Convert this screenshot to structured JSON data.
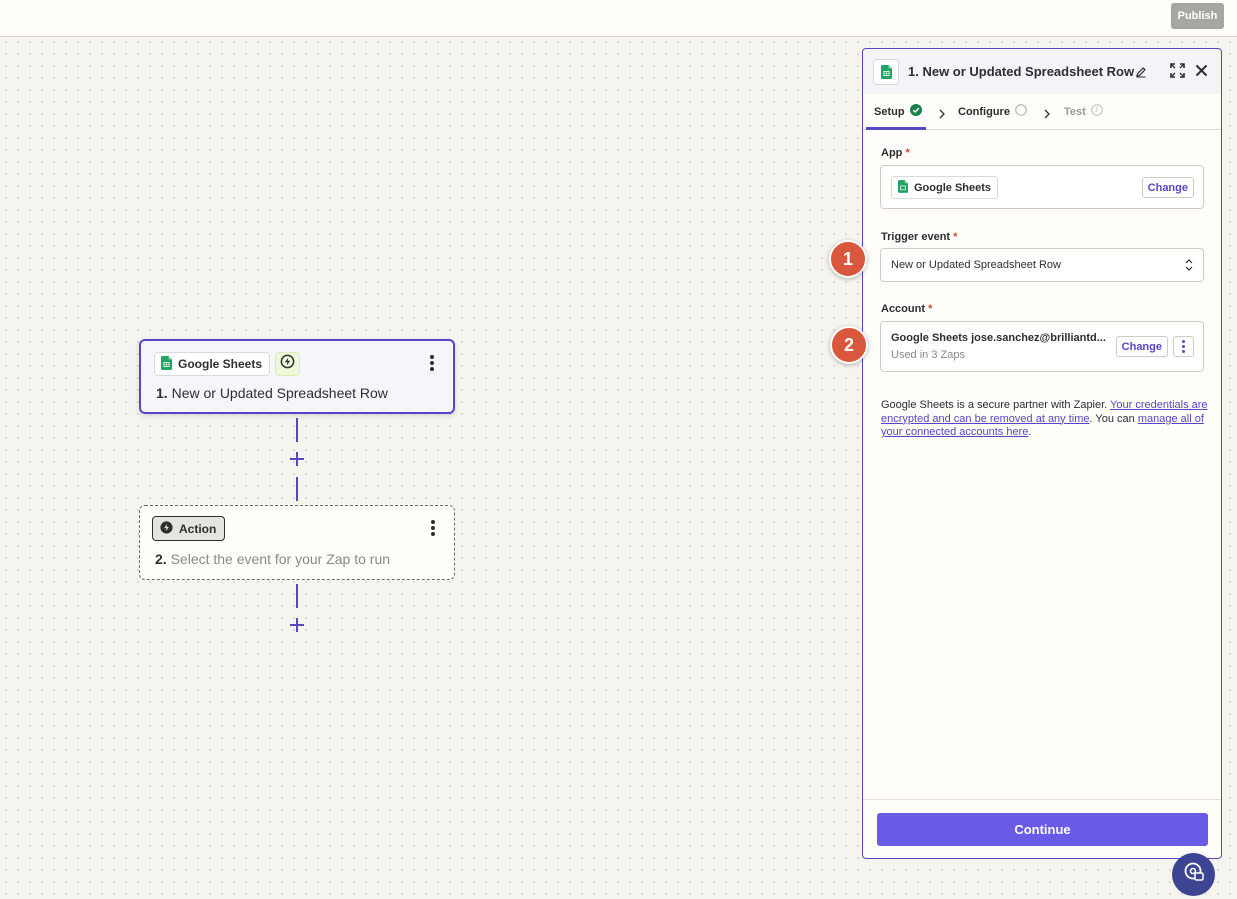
{
  "topbar": {
    "publish_label": "Publish"
  },
  "canvas": {
    "trigger_node": {
      "app_name": "Google Sheets",
      "step_number": "1.",
      "title": "New or Updated Spreadsheet Row"
    },
    "action_node": {
      "chip_label": "Action",
      "step_number": "2.",
      "title": "Select the event for your Zap to run"
    }
  },
  "panel": {
    "title": "1. New or Updated Spreadsheet Row",
    "tabs": [
      {
        "label": "Setup",
        "status": "complete"
      },
      {
        "label": "Configure",
        "status": "incomplete"
      },
      {
        "label": "Test",
        "status": "disabled"
      }
    ],
    "app": {
      "label": "App",
      "required_mark": "*",
      "value": "Google Sheets",
      "change_label": "Change"
    },
    "trigger_event": {
      "label": "Trigger event",
      "required_mark": "*",
      "value": "New or Updated Spreadsheet Row"
    },
    "account": {
      "label": "Account",
      "required_mark": "*",
      "value": "Google Sheets jose.sanchez@brilliantd...",
      "usage": "Used in 3 Zaps",
      "change_label": "Change"
    },
    "info": {
      "text_1": "Google Sheets is a secure partner with Zapier. ",
      "link_1": "Your credentials are encrypted and can be removed at any time",
      "text_2": ". You can ",
      "link_2": "manage all of your connected accounts here",
      "text_3": "."
    },
    "continue_label": "Continue"
  },
  "markers": [
    "1",
    "2"
  ],
  "colors": {
    "accent": "#5648c4",
    "continue_button": "#695be8",
    "marker": "#d9573c",
    "sheets_green": "#1fa463",
    "help_button": "#3d4592"
  },
  "icons": [
    "google-sheets-icon",
    "bolt-icon",
    "pencil-icon",
    "expand-icon",
    "close-icon",
    "check-circle-icon",
    "chevron-right-icon",
    "updown-icon",
    "kebab-icon",
    "help-chat-icon"
  ]
}
